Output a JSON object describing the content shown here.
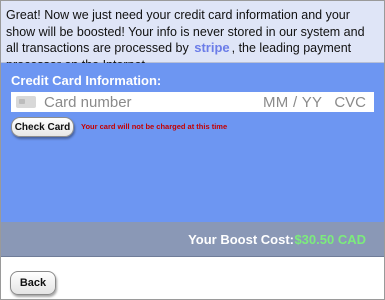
{
  "info": {
    "line1": "Great! Now we just need your credit card information and your show will be boosted! Your info is never stored in our system and all transactions are processed by",
    "stripe_word": "stripe",
    "line2": ", the leading payment processor on the Internet."
  },
  "credit_card": {
    "title": "Credit Card Information:",
    "number_placeholder": "Card number",
    "exp_placeholder": "MM / YY",
    "cvc_placeholder": "CVC",
    "check_button": "Check Card",
    "notice": "Your card will not be charged at this time"
  },
  "cost": {
    "label": "Your Boost Cost:",
    "value": "$30.50 CAD"
  },
  "footer": {
    "back_button": "Back"
  },
  "colors": {
    "panel_blue": "#6d96f2",
    "info_bg": "#dfe5f7",
    "cost_bar": "#8a98b6",
    "cost_green": "#7cec7c",
    "notice_red": "#c40000"
  },
  "icons": [
    "credit-card-icon"
  ]
}
